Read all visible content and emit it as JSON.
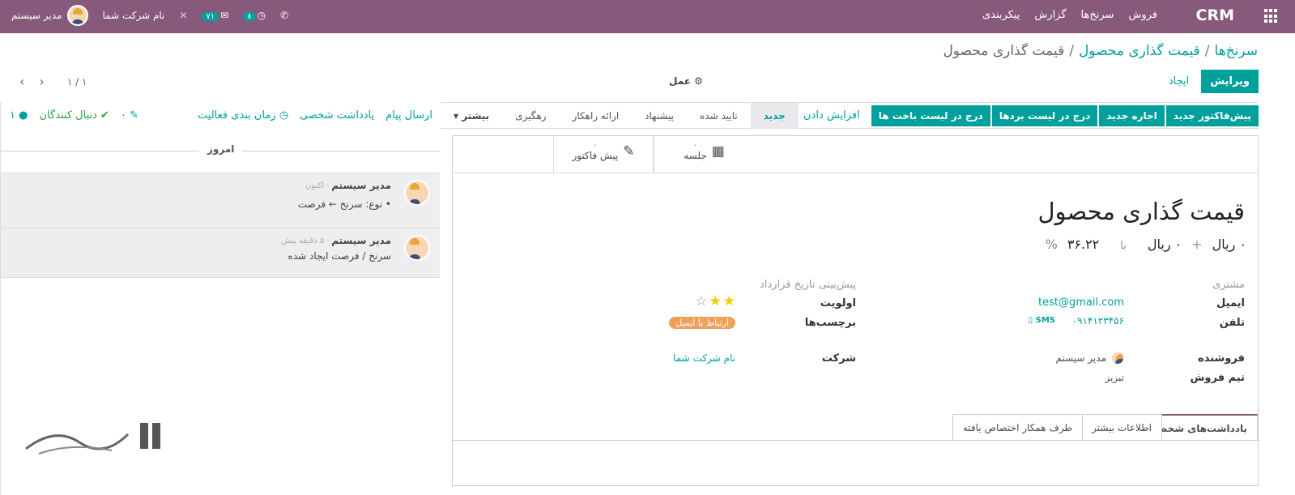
{
  "topbar": {
    "brand": "CRM",
    "menu": [
      "فروش",
      "سرنخ‌ها",
      "گزارش",
      "پیکربندی"
    ],
    "company": "نام شرکت شما",
    "user": "مدیر سیستم",
    "activity_count": "۸",
    "message_count": "۷۱"
  },
  "breadcrumb": {
    "leads": "سرنخ‌ها",
    "pricing": "قیمت گذاری محصول",
    "current": "قیمت گذاری محصول"
  },
  "control": {
    "edit": "ویرایش",
    "create": "ایجاد",
    "action": "عمل",
    "pager": "۱ / ۱"
  },
  "statusbar": {
    "buttons": [
      "پیش‌فاکتور جدید",
      "اجاره جدید",
      "درج در لیست بردها",
      "درج در لیست باخت ها"
    ],
    "increase": "افزایش دادن",
    "stages": [
      "جدید",
      "تایید شده",
      "پیشنهاد",
      "ارائه راهکار",
      "رهگیری",
      "بیشتر"
    ]
  },
  "smart": {
    "meeting": "جلسه",
    "meeting_count": "۰",
    "quote": "پیش فاکتور",
    "quote_count": "۰"
  },
  "record": {
    "title": "قیمت گذاری محصول",
    "revenue": "۰ ریال",
    "plus": "+",
    "extra": "۰ ریال",
    "at": "با",
    "prob": "۳۶.۲۲",
    "prob_unit": "%",
    "customer_label": "مشتری",
    "email_label": "ایمیل",
    "email": "test@gmail.com",
    "phone_label": "تلفن",
    "phone": "۰۹۱۴۱۲۳۴۵۶",
    "sms": "SMS",
    "close_label": "پیش‌بینی تاریخ قرارداد",
    "priority_label": "اولویت",
    "tags_label": "برچسب‌ها",
    "tag": "ارتباط با ایمیل",
    "company_label": "شرکت",
    "company": "نام شرکت شما",
    "salesperson_label": "فروشنده",
    "salesperson": "مدیر سیستم",
    "team_label": "تیم فروش",
    "team": "تبریز",
    "priority": 2,
    "priority_max": 3
  },
  "tabs": [
    "یادداشت‌های شخصی",
    "اطلاعات بیشتر",
    "طرف همکار اختصاص یافته"
  ],
  "chatter": {
    "send": "ارسال پیام",
    "note": "یادداشت شخصی",
    "schedule": "زمان بندی فعالیت",
    "attach_count": "۰",
    "follow": "دنبال کنندگان",
    "followers": "۱",
    "today": "امروز",
    "messages": [
      {
        "author": "مدیر سیستم",
        "time": "- اکنون",
        "body": "نوع: سرنخ ← فرصت"
      },
      {
        "author": "مدیر سیستم",
        "time": "- ۵ دقیقه پیش",
        "body": "سرنخ / فرصت ایجاد شده"
      }
    ]
  },
  "colors": {
    "topbar": "#875a7b",
    "accent": "#00a09d",
    "tag": "#f0a05b",
    "star": "#f3cc00"
  }
}
